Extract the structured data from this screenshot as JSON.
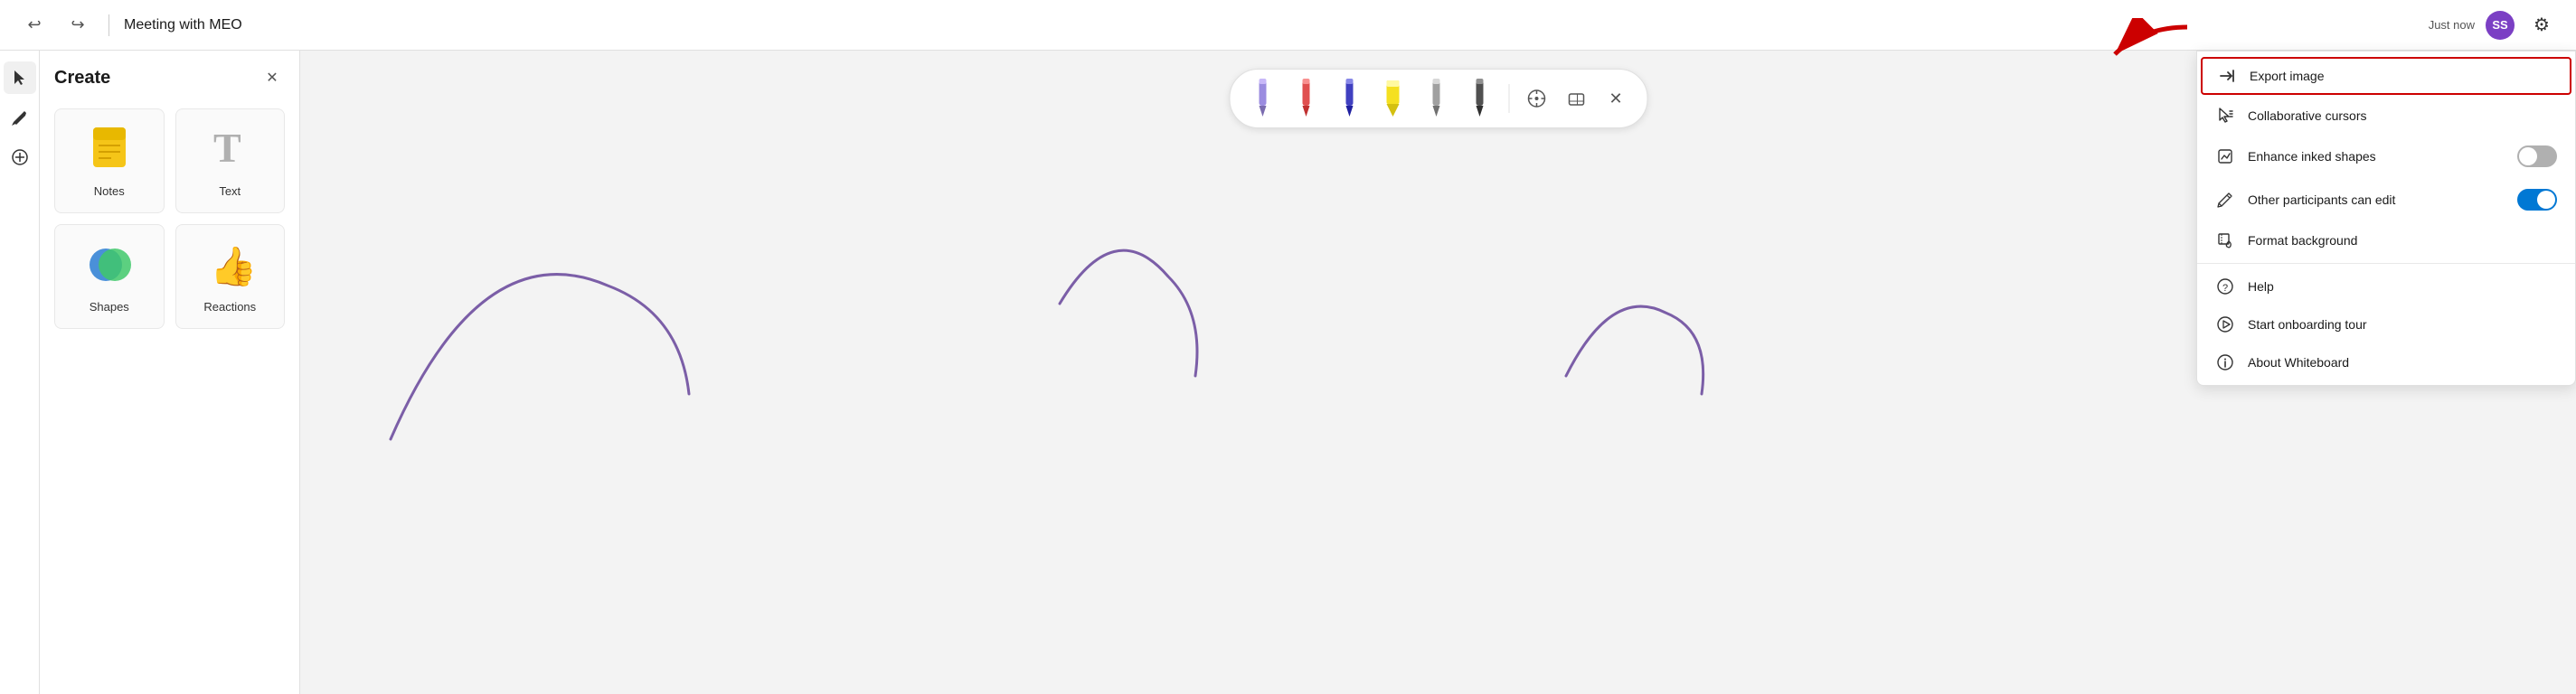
{
  "titleBar": {
    "title": "Meeting with MEO",
    "justNow": "Just now",
    "avatarInitials": "SS",
    "undoLabel": "Undo",
    "redoLabel": "Redo"
  },
  "leftToolbar": {
    "selectLabel": "Select",
    "penLabel": "Pen",
    "addLabel": "Add"
  },
  "sidePanel": {
    "title": "Create",
    "closeLabel": "Close",
    "items": [
      {
        "id": "notes",
        "label": "Notes",
        "icon": "📝"
      },
      {
        "id": "text",
        "label": "Text",
        "icon": "T"
      },
      {
        "id": "shapes",
        "label": "Shapes",
        "icon": "🔵"
      },
      {
        "id": "reactions",
        "label": "Reactions",
        "icon": "👍"
      }
    ]
  },
  "penToolbar": {
    "pens": [
      {
        "id": "pen-purple",
        "color": "purple",
        "label": "Purple pen"
      },
      {
        "id": "pen-red",
        "color": "red",
        "label": "Red pen"
      },
      {
        "id": "pen-dark-blue",
        "color": "dark-blue",
        "label": "Dark blue pen"
      },
      {
        "id": "pen-yellow",
        "color": "yellow",
        "label": "Yellow highlighter"
      },
      {
        "id": "pen-gray",
        "color": "gray",
        "label": "Gray pen"
      },
      {
        "id": "pen-dark",
        "color": "dark",
        "label": "Dark pen"
      }
    ],
    "rulerLabel": "Ruler",
    "eraserLabel": "Eraser",
    "closeLabel": "Close toolbar"
  },
  "dropdownMenu": {
    "items": [
      {
        "id": "export-image",
        "icon": "export",
        "label": "Export image",
        "highlighted": true
      },
      {
        "id": "collaborative-cursors",
        "icon": "cursor",
        "label": "Collaborative cursors",
        "toggle": "none"
      },
      {
        "id": "enhance-inked-shapes",
        "icon": "enhance",
        "label": "Enhance inked shapes",
        "toggle": "off"
      },
      {
        "id": "other-participants-edit",
        "icon": "edit",
        "label": "Other participants can edit",
        "toggle": "on"
      },
      {
        "id": "format-background",
        "icon": "format",
        "label": "Format background",
        "toggle": "none"
      },
      {
        "id": "help",
        "icon": "help",
        "label": "Help",
        "toggle": "none"
      },
      {
        "id": "start-onboarding",
        "icon": "play",
        "label": "Start onboarding tour",
        "toggle": "none"
      },
      {
        "id": "about-whiteboard",
        "icon": "info",
        "label": "About Whiteboard",
        "toggle": "none"
      }
    ]
  },
  "icons": {
    "undo": "↩",
    "redo": "↪",
    "select": "▲",
    "pen": "✏",
    "add": "＋",
    "close": "✕",
    "gear": "⚙",
    "ruler": "📏",
    "eraser": "🗑",
    "export": "→|",
    "cursor": "🖱",
    "enhance": "⟡",
    "edit": "✎",
    "format": "🖼",
    "help": "?",
    "play": "▷",
    "info": "ⓘ"
  }
}
